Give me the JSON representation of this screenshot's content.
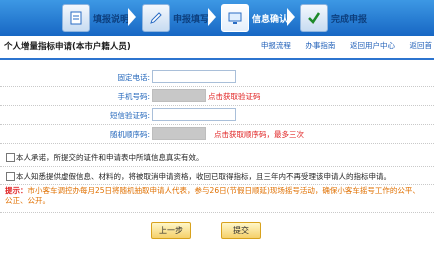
{
  "steps": [
    {
      "label": "填报说明",
      "active": false
    },
    {
      "label": "申报填写",
      "active": false
    },
    {
      "label": "信息确认",
      "active": true
    },
    {
      "label": "完成申报",
      "active": false
    }
  ],
  "page_title": "个人增量指标申请(本市户籍人员)",
  "top_links": [
    "申报流程",
    "办事指南",
    "返回用户中心",
    "返回首"
  ],
  "form": {
    "fixed_phone_label": "固定电话:",
    "mobile_label": "手机号码:",
    "mobile_link": "点击获取验证码",
    "verify_code_label": "短信验证码:",
    "random_code_label": "随机顺序码:",
    "random_code_link": "点击获取顺序码，最多三次"
  },
  "agreements": [
    "本人承诺，所提交的证件和申请表中所填信息真实有效。",
    "本人知悉提供虚假信息、材料的，将被取消申请资格，收回已取得指标，且三年内不再受理该申请人的指标申请。"
  ],
  "notice": {
    "prefix": "提示：",
    "text": "市小客车调控办每月25日将随机抽取申请人代表，参与26日(节假日顺延)现场摇号活动，确保小客车摇号工作的公平、公正、公开。"
  },
  "buttons": {
    "prev": "上一步",
    "submit": "提交"
  },
  "colors": {
    "header_blue": "#1767c4",
    "link_blue": "#1f5fb8",
    "link_red": "#e02222",
    "notice_orange": "#e07000"
  }
}
